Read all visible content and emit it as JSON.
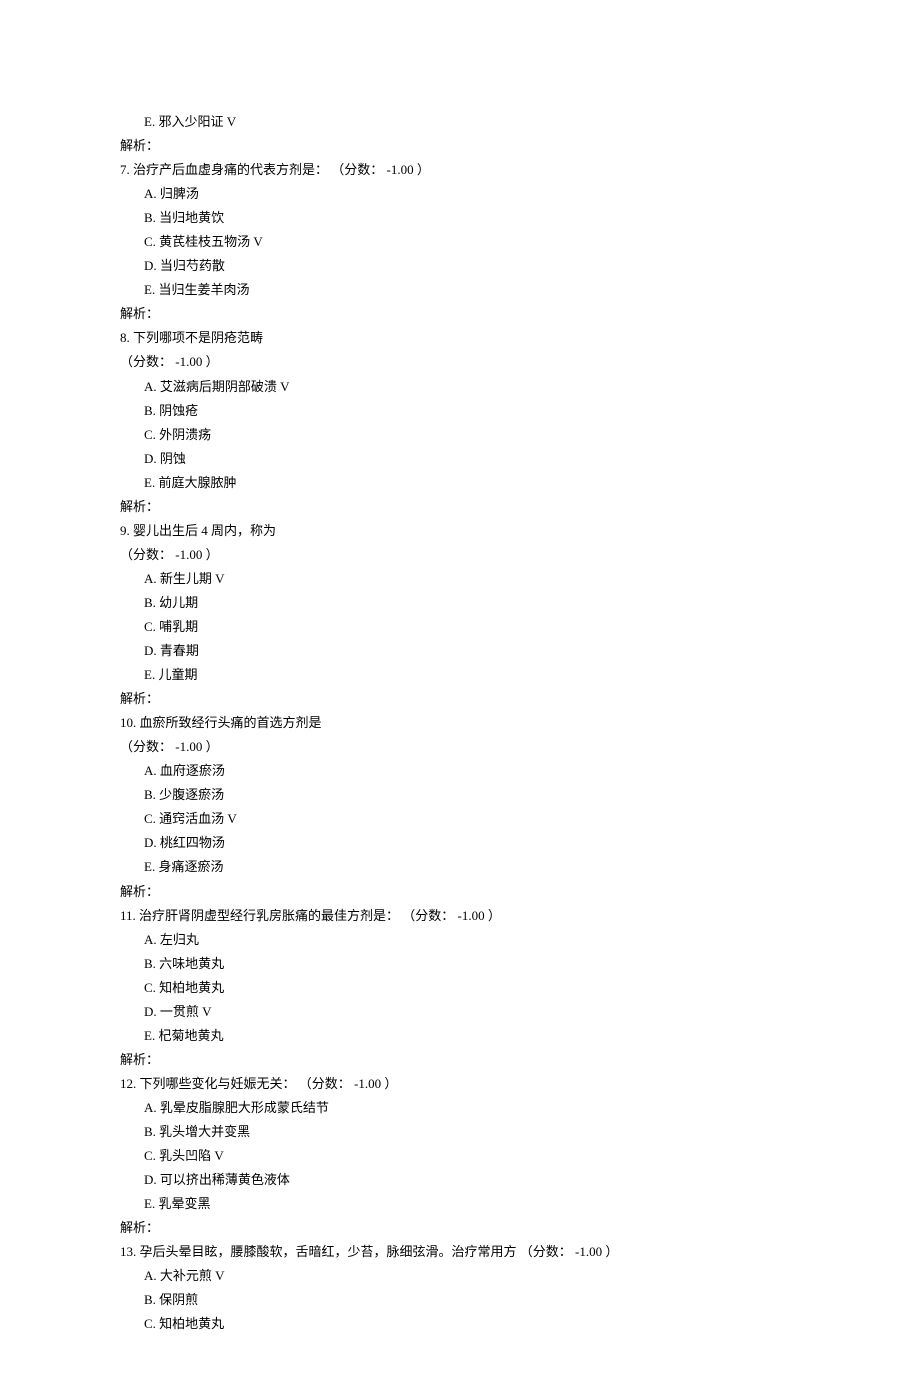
{
  "q6": {
    "options": {
      "E": "E.  邪入少阳证  V"
    },
    "explain": "解析："
  },
  "q7": {
    "text": "7.  治疗产后血虚身痛的代表方剂是： （分数：  -1.00 ）",
    "options": {
      "A": "A.  归脾汤",
      "B": "B.  当归地黄饮",
      "C": "C.  黄芪桂枝五物汤  V",
      "D": "D.  当归芍药散",
      "E": "E.  当归生姜羊肉汤"
    },
    "explain": "解析："
  },
  "q8": {
    "text": "8.  下列哪项不是阴疮范畴",
    "score": "（分数：  -1.00 ）",
    "options": {
      "A": "A.  艾滋病后期阴部破溃  V",
      "B": "B.  阴蚀疮",
      "C": "C.  外阴溃疡",
      "D": "D.  阴蚀",
      "E": "E.  前庭大腺脓肿"
    },
    "explain": "解析："
  },
  "q9": {
    "text": "9.  婴儿出生后  4 周内，称为",
    "score": "（分数：  -1.00 ）",
    "options": {
      "A": "A.  新生儿期  V",
      "B": "B.  幼儿期",
      "C": "C.  哺乳期",
      "D": "D.  青春期",
      "E": "E.  儿童期"
    },
    "explain": "解析："
  },
  "q10": {
    "text": "10.   血瘀所致经行头痛的首选方剂是",
    "score": "（分数：  -1.00 ）",
    "options": {
      "A": "A.  血府逐瘀汤",
      "B": "B.  少腹逐瘀汤",
      "C": "C.  通窍活血汤  V",
      "D": "D.  桃红四物汤",
      "E": "E.  身痛逐瘀汤"
    },
    "explain": "解析："
  },
  "q11": {
    "text": "11.   治疗肝肾阴虚型经行乳房胀痛的最佳方剂是： （分数：  -1.00 ）",
    "options": {
      "A": "A.  左归丸",
      "B": "B.  六味地黄丸",
      "C": "C.  知柏地黄丸",
      "D": "D.  一贯煎  V",
      "E": "E.  杞菊地黄丸"
    },
    "explain": "解析："
  },
  "q12": {
    "text": "12.   下列哪些变化与妊娠无关： （分数：  -1.00 ）",
    "options": {
      "A": "A.  乳晕皮脂腺肥大形成蒙氏结节",
      "B": "B.  乳头增大并变黑",
      "C": "C.  乳头凹陷  V",
      "D": "D.  可以挤出稀薄黄色液体",
      "E": "E.  乳晕变黑"
    },
    "explain": "解析："
  },
  "q13": {
    "text": "13.   孕后头晕目眩，腰膝酸软，舌暗红，少苔，脉细弦滑。治疗常用方  （分数：  -1.00 ）",
    "options": {
      "A": "A.  大补元煎  V",
      "B": "B.  保阴煎",
      "C": "C.  知柏地黄丸"
    }
  }
}
